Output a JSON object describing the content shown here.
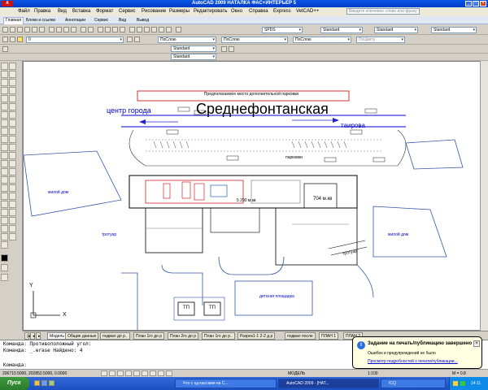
{
  "window": {
    "title": "AutoCAD 2009 НАТАЛКА ФАС+ИНТЕРЬЕР 5",
    "logo": "A",
    "search_placeholder": "Введите ключевое слово или фразу"
  },
  "menu": [
    "Файл",
    "Правка",
    "Вид",
    "Вставка",
    "Формат",
    "Сервис",
    "Рисование",
    "Размеры",
    "Редактировать",
    "Окно",
    "Справка",
    "Express",
    "VetCAD++"
  ],
  "ribbon_tabs": [
    "Главная",
    "Блоки и ссылки",
    "Аннотации",
    "Сервис",
    "Вид",
    "Вывод"
  ],
  "toolbar": {
    "layer": "0",
    "color": "ПоСлою",
    "linetype": "ПоСлою",
    "lineweight": "ПоСлою",
    "plot_style": "ПоЦвету",
    "text_style": "SPDS",
    "dim_style": "Standard",
    "table_style": "Standard",
    "mleader_style": "Standard",
    "visual_style": "Standard",
    "scale_list": "Standard"
  },
  "drawing": {
    "title_label": "Среднефонтанская",
    "street_left": "центр города",
    "street_right": "таирова",
    "top_note": "Предполагаемое место дополнительной парковки",
    "parking_label": "парковки",
    "area_left": "5 290 м.кв",
    "area_right": "704 м.кв",
    "house_left": "жилой дом",
    "house_right": "жилой дом",
    "sidewalk_left": "тротуар",
    "sidewalk_right": "тротуар",
    "playground": "детская площадка",
    "tp1": "ТП",
    "tp2": "ТП",
    "axis_x": "X",
    "axis_y": "Y"
  },
  "layout_tabs": [
    "Модель",
    "Общие данные",
    "подвал до р..",
    "План 1го до р",
    "План 2го до р",
    "План 1го до р..",
    "Разрез1-1 2-2 д.р",
    "подвал после",
    "ПЛАН 1",
    "ПЛАН 2"
  ],
  "command_lines": [
    "Команда: Противоположный угол:",
    "Команда: _.erase Найдено: 4",
    "",
    "Команда:"
  ],
  "status": {
    "coords": "206710.5000, 202852.5000, 0.0000",
    "model": "МОДЕЛЬ",
    "scale": "1:100",
    "zoom": "М = 0.8"
  },
  "balloon": {
    "title": "Задание на печать/публикацию завершено",
    "line1": "Ошибок и предупреждений не было",
    "link": "Просмотр подробностей о печати/публикации..."
  },
  "taskbar": {
    "start": "Пуск",
    "tasks": [
      "Что с хд кассами на С...",
      "AutoCAD 2009 - [НАТ...",
      "ICQ"
    ],
    "clock": "14:11"
  }
}
